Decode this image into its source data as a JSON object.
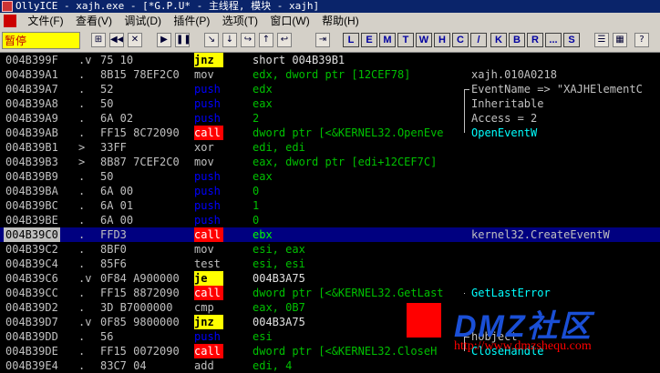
{
  "titlebar": {
    "text": "OllyICE - xajh.exe - [*G.P.U* -  主线程, 模块 - xajh]"
  },
  "menubar": {
    "items": [
      "文件(F)",
      "查看(V)",
      "调试(D)",
      "插件(P)",
      "选项(T)",
      "窗口(W)",
      "帮助(H)"
    ]
  },
  "toolbar": {
    "status": "暂停",
    "icon_buttons": [
      "⊞",
      "◀◀",
      "✕",
      "▶",
      "❚❚",
      "↘",
      "↓",
      "↪",
      "↑",
      "↩",
      "⇥"
    ],
    "letter_buttons": [
      "L",
      "E",
      "M",
      "T",
      "W",
      "H",
      "C",
      "/",
      "K",
      "B",
      "R",
      "...",
      "S"
    ],
    "right_buttons": [
      "☰",
      "▦",
      "?"
    ]
  },
  "rows": [
    {
      "addr": "004B399F",
      "mark": ".v",
      "hex": "75 10",
      "mn": "jnz",
      "mn_style": "jmp",
      "op": "short 004B39B1",
      "op_style": "white",
      "comment": ""
    },
    {
      "addr": "004B39A1",
      "mark": ".",
      "hex": "8B15 78EF2C0",
      "mn": "mov",
      "mn_style": "plain",
      "op": "edx, dword ptr [12CEF78]",
      "op_style": "green",
      "comment": "xajh.010A0218"
    },
    {
      "addr": "004B39A7",
      "mark": ".",
      "hex": "52",
      "mn": "push",
      "mn_style": "push",
      "op": "edx",
      "op_style": "green",
      "comment": "EventName => \"XAJHElementC"
    },
    {
      "addr": "004B39A8",
      "mark": ".",
      "hex": "50",
      "mn": "push",
      "mn_style": "push",
      "op": "eax",
      "op_style": "green",
      "comment": "Inheritable"
    },
    {
      "addr": "004B39A9",
      "mark": ".",
      "hex": "6A 02",
      "mn": "push",
      "mn_style": "push",
      "op": "2",
      "op_style": "green",
      "comment": "Access = 2"
    },
    {
      "addr": "004B39AB",
      "mark": ".",
      "hex": "FF15 8C72090",
      "mn": "call",
      "mn_style": "call",
      "op": "dword ptr [<&KERNEL32.OpenEve",
      "op_style": "green",
      "comment": "OpenEventW",
      "comment_style": "cyan"
    },
    {
      "addr": "004B39B1",
      "mark": ">",
      "hex": "33FF",
      "mn": "xor",
      "mn_style": "plain",
      "op": "edi, edi",
      "op_style": "green",
      "comment": ""
    },
    {
      "addr": "004B39B3",
      "mark": ">",
      "hex": "8B87 7CEF2C0",
      "mn": "mov",
      "mn_style": "plain",
      "op": "eax, dword ptr [edi+12CEF7C]",
      "op_style": "green",
      "comment": ""
    },
    {
      "addr": "004B39B9",
      "mark": ".",
      "hex": "50",
      "mn": "push",
      "mn_style": "push",
      "op": "eax",
      "op_style": "green",
      "comment": ""
    },
    {
      "addr": "004B39BA",
      "mark": ".",
      "hex": "6A 00",
      "mn": "push",
      "mn_style": "push",
      "op": "0",
      "op_style": "green",
      "comment": ""
    },
    {
      "addr": "004B39BC",
      "mark": ".",
      "hex": "6A 01",
      "mn": "push",
      "mn_style": "push",
      "op": "1",
      "op_style": "green",
      "comment": ""
    },
    {
      "addr": "004B39BE",
      "mark": ".",
      "hex": "6A 00",
      "mn": "push",
      "mn_style": "push",
      "op": "0",
      "op_style": "green",
      "comment": ""
    },
    {
      "addr": "004B39C0",
      "mark": ".",
      "hex": "FFD3",
      "mn": "call",
      "mn_style": "call",
      "op": "ebx",
      "op_style": "green-hi",
      "comment": "kernel32.CreateEventW",
      "selected": true
    },
    {
      "addr": "004B39C2",
      "mark": ".",
      "hex": "8BF0",
      "mn": "mov",
      "mn_style": "plain",
      "op": "esi, eax",
      "op_style": "green",
      "comment": ""
    },
    {
      "addr": "004B39C4",
      "mark": ".",
      "hex": "85F6",
      "mn": "test",
      "mn_style": "plain",
      "op": "esi, esi",
      "op_style": "green",
      "comment": ""
    },
    {
      "addr": "004B39C6",
      "mark": ".v",
      "hex": "0F84 A900000",
      "mn": "je",
      "mn_style": "jmp",
      "op": "004B3A75",
      "op_style": "white",
      "comment": ""
    },
    {
      "addr": "004B39CC",
      "mark": ".",
      "hex": "FF15 8872090",
      "mn": "call",
      "mn_style": "call",
      "op": "dword ptr [<&KERNEL32.GetLast",
      "op_style": "green",
      "comment": "GetLastError",
      "comment_style": "cyan"
    },
    {
      "addr": "004B39D2",
      "mark": ".",
      "hex": "3D B7000000",
      "mn": "cmp",
      "mn_style": "plain",
      "op": "eax, 0B7",
      "op_style": "green",
      "comment": ""
    },
    {
      "addr": "004B39D7",
      "mark": ".v",
      "hex": "0F85 9800000",
      "mn": "jnz",
      "mn_style": "jmp",
      "op": "004B3A75",
      "op_style": "white",
      "comment": ""
    },
    {
      "addr": "004B39DD",
      "mark": ".",
      "hex": "56",
      "mn": "push",
      "mn_style": "push",
      "op": "esi",
      "op_style": "green",
      "comment": "hObject"
    },
    {
      "addr": "004B39DE",
      "mark": ".",
      "hex": "FF15 0072090",
      "mn": "call",
      "mn_style": "call",
      "op": "dword ptr [<&KERNEL32.CloseH",
      "op_style": "green",
      "comment": "CloseHandle",
      "comment_style": "cyan"
    },
    {
      "addr": "004B39E4",
      "mark": ".",
      "hex": "83C7 04",
      "mn": "add",
      "mn_style": "plain",
      "op": "edi, 4",
      "op_style": "green",
      "comment": ""
    }
  ],
  "watermark": {
    "logo": "DMZ社区",
    "url": "http://www.dmzshequ.com"
  }
}
